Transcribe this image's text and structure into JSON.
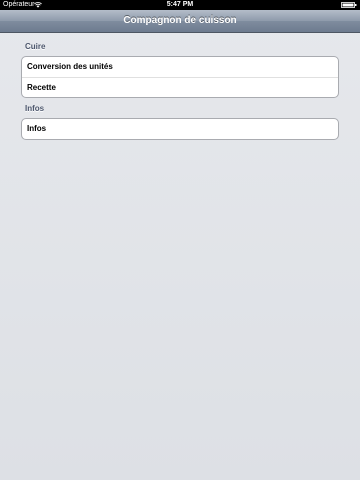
{
  "status_bar": {
    "carrier": "Opérateur",
    "time": "5:47 PM"
  },
  "nav_bar": {
    "title": "Compagnon de cuisson"
  },
  "sections": [
    {
      "header": "Cuire",
      "items": [
        {
          "label": "Conversion des unités"
        },
        {
          "label": "Recette"
        }
      ]
    },
    {
      "header": "Infos",
      "items": [
        {
          "label": "Infos"
        }
      ]
    }
  ],
  "colors": {
    "nav_bar": "#8e9aab",
    "background": "#e3e5e9",
    "section_header": "#4c566c"
  }
}
